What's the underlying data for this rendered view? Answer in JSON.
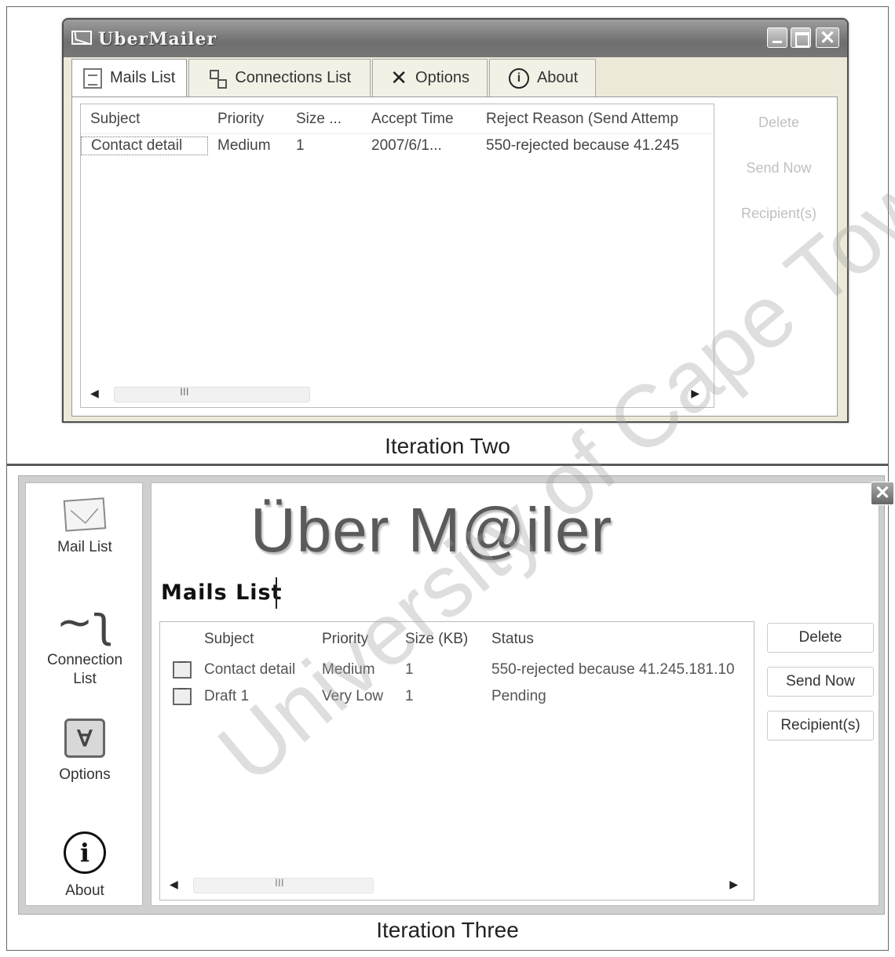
{
  "iteration_two": {
    "window_title": "UberMailer",
    "tabs": [
      {
        "label": "Mails List",
        "icon": "mail-list-icon"
      },
      {
        "label": "Connections List",
        "icon": "network-icon"
      },
      {
        "label": "Options",
        "icon": "tools-icon"
      },
      {
        "label": "About",
        "icon": "info-icon"
      }
    ],
    "columns": [
      "Subject",
      "Priority",
      "Size ...",
      "Accept Time",
      "Reject Reason (Send Attemp"
    ],
    "rows": [
      [
        "Contact detail",
        "Medium",
        "1",
        "2007/6/1...",
        "550-rejected because 41.245"
      ]
    ],
    "side_buttons": [
      "Delete",
      "Send Now",
      "Recipient(s)"
    ],
    "scroll_grip": "III",
    "caption": "Iteration Two"
  },
  "iteration_three": {
    "logo": "Über M@iler",
    "section_title": "Mails List",
    "nav": [
      {
        "label": "Mail List",
        "icon": "envelope-icon"
      },
      {
        "label": "Connection List",
        "icon": "connection-icon"
      },
      {
        "label": "Options",
        "icon": "options-icon"
      },
      {
        "label": "About",
        "icon": "info-icon"
      }
    ],
    "columns": [
      "",
      "Subject",
      "Priority",
      "Size (KB)",
      "Status"
    ],
    "rows": [
      [
        "",
        "Contact detail",
        "Medium",
        "1",
        "550-rejected because 41.245.181.10"
      ],
      [
        "",
        "Draft 1",
        "Very Low",
        "1",
        "Pending"
      ]
    ],
    "side_buttons": [
      "Delete",
      "Send Now",
      "Recipient(s)"
    ],
    "scroll_grip": "III",
    "caption": "Iteration Three"
  },
  "watermark": "University of Cape Town",
  "colors": {
    "window_face": "#ece9d8",
    "titlebar": "#7a7a7a",
    "disabled_text": "#c0c0c0"
  }
}
